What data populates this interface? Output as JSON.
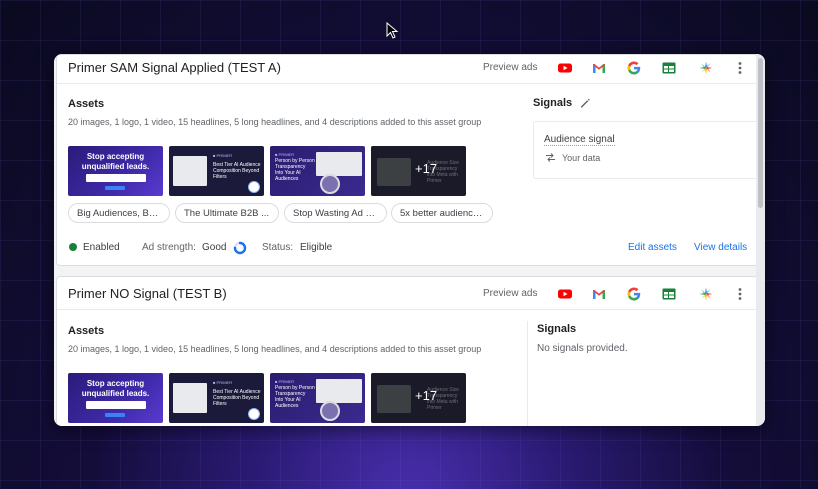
{
  "cards": [
    {
      "title": "Primer SAM Signal Applied (TEST A)",
      "preview_label": "Preview ads",
      "assets_title": "Assets",
      "assets_desc": "20 images, 1 logo, 1 video, 15 headlines, 5 long headlines, and 4 descriptions added to this asset group",
      "thumbs": [
        {
          "text": "Stop accepting unqualified leads."
        },
        {
          "logo": "■ PRIMER",
          "text": "Best Tier AI Audience Composition Beyond Filters"
        },
        {
          "logo": "■ PRIMER",
          "text": "Person by Person Transparency Into Your AI Audiences"
        },
        {
          "plus": "+17",
          "faint": "Audience Size Transparency into Meta with Primer"
        }
      ],
      "headlines": [
        "Big Audiences, Be...",
        "The Ultimate B2B ...",
        "Stop Wasting Ad S...",
        "5x better audience..."
      ],
      "status": {
        "enabled": "Enabled",
        "ad_strength_label": "Ad strength:",
        "ad_strength_value": "Good",
        "status_label": "Status:",
        "status_value": "Eligible",
        "ad_strength_fraction": 0.75
      },
      "actions": {
        "edit": "Edit assets",
        "view": "View details"
      },
      "signals_title": "Signals",
      "signal": {
        "name": "Audience signal",
        "sub": "Your data"
      }
    },
    {
      "title": "Primer NO Signal (TEST B)",
      "preview_label": "Preview ads",
      "assets_title": "Assets",
      "assets_desc": "20 images, 1 logo, 1 video, 15 headlines, 5 long headlines, and 4 descriptions added to this asset group",
      "thumbs": [
        {
          "text": "Stop accepting unqualified leads."
        },
        {
          "logo": "■ PRIMER",
          "text": "Best Tier AI Audience Composition Beyond Filters"
        },
        {
          "logo": "■ PRIMER",
          "text": "Person by Person Transparency Into Your AI Audiences"
        },
        {
          "plus": "+17",
          "faint": "Audience Size Transparency into Meta with Primer"
        }
      ],
      "signals_title": "Signals",
      "no_signals": "No signals provided."
    }
  ],
  "icons": {
    "header": [
      "youtube-icon",
      "gmail-icon",
      "google-icon",
      "sheets-icon",
      "discover-icon",
      "more-vert-icon"
    ],
    "edit": "pencil-icon",
    "signal_sub": "sync-icon",
    "cursor": "cursor-icon"
  },
  "colors": {
    "link": "#1a73e8",
    "enabled": "#188038",
    "youtube": "#ff0000",
    "sheets": "#188038"
  }
}
